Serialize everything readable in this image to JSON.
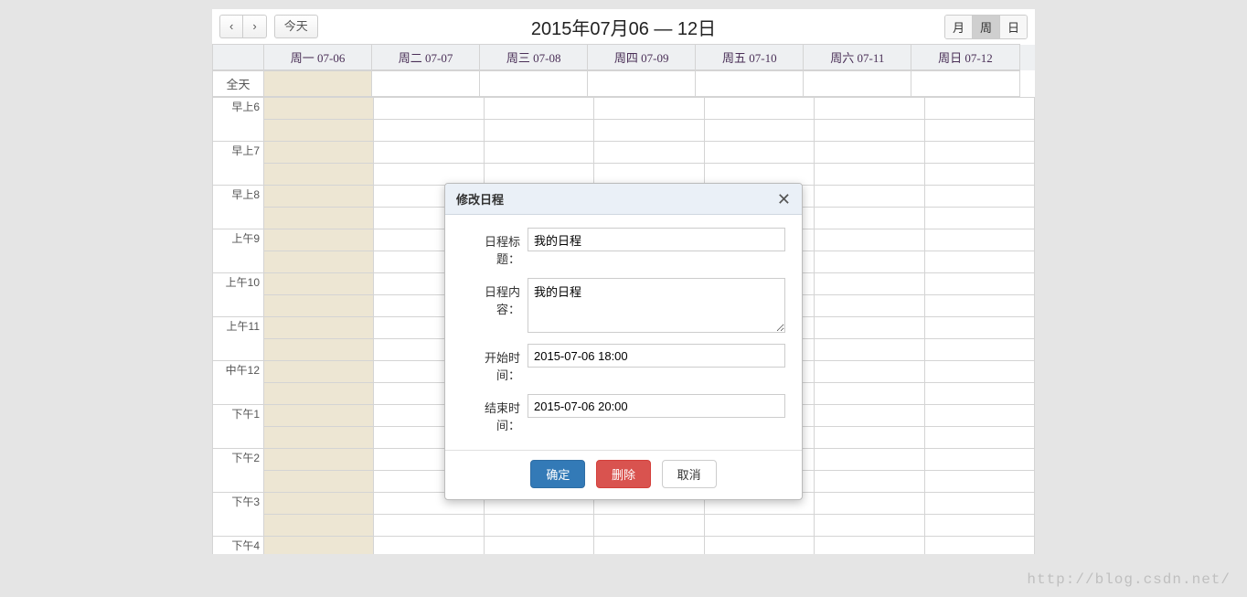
{
  "toolbar": {
    "prev_icon": "‹",
    "next_icon": "›",
    "today_label": "今天",
    "title": "2015年07月06 — 12日",
    "views": {
      "month": "月",
      "week": "周",
      "day": "日"
    },
    "active_view": "week"
  },
  "header": {
    "axis": "",
    "days": [
      "周一 07-06",
      "周二 07-07",
      "周三 07-08",
      "周四 07-09",
      "周五 07-10",
      "周六 07-11",
      "周日 07-12"
    ],
    "highlight_index": 0
  },
  "allday_label": "全天",
  "time_slots": [
    "早上6",
    "早上7",
    "早上8",
    "上午9",
    "上午10",
    "上午11",
    "中午12",
    "下午1",
    "下午2",
    "下午3",
    "下午4"
  ],
  "modal": {
    "title": "修改日程",
    "fields": {
      "title_label": "日程标题：",
      "title_value": "我的日程",
      "content_label": "日程内容：",
      "content_value": "我的日程",
      "start_label": "开始时间：",
      "start_value": "2015-07-06 18:00",
      "end_label": "结束时间：",
      "end_value": "2015-07-06 20:00"
    },
    "buttons": {
      "ok": "确定",
      "delete": "删除",
      "cancel": "取消"
    }
  },
  "watermark": "http://blog.csdn.net/"
}
